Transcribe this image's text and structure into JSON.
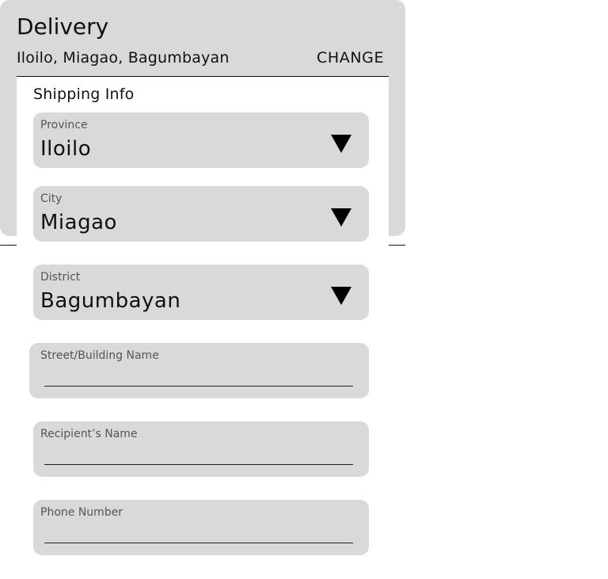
{
  "delivery": {
    "title": "Delivery",
    "address": "Iloilo, Miagao, Bagumbayan",
    "change_label": "CHANGE"
  },
  "shipping_info": {
    "title": "Shipping Info",
    "province": {
      "label": "Province",
      "value": "Iloilo"
    },
    "city": {
      "label": "City",
      "value": "Miagao"
    },
    "district": {
      "label": "District",
      "value": "Bagumbayan"
    },
    "street": {
      "label": "Street/Building Name",
      "value": ""
    },
    "recipient": {
      "label": "Recipient’s Name",
      "value": ""
    },
    "phone": {
      "label": "Phone Number",
      "value": ""
    }
  },
  "icons": {
    "dropdown": "triangle-down-icon"
  },
  "colors": {
    "card_background": "#d9d9d9",
    "field_background": "#d9d9d9",
    "text": "#111111",
    "label_text": "#555555"
  }
}
